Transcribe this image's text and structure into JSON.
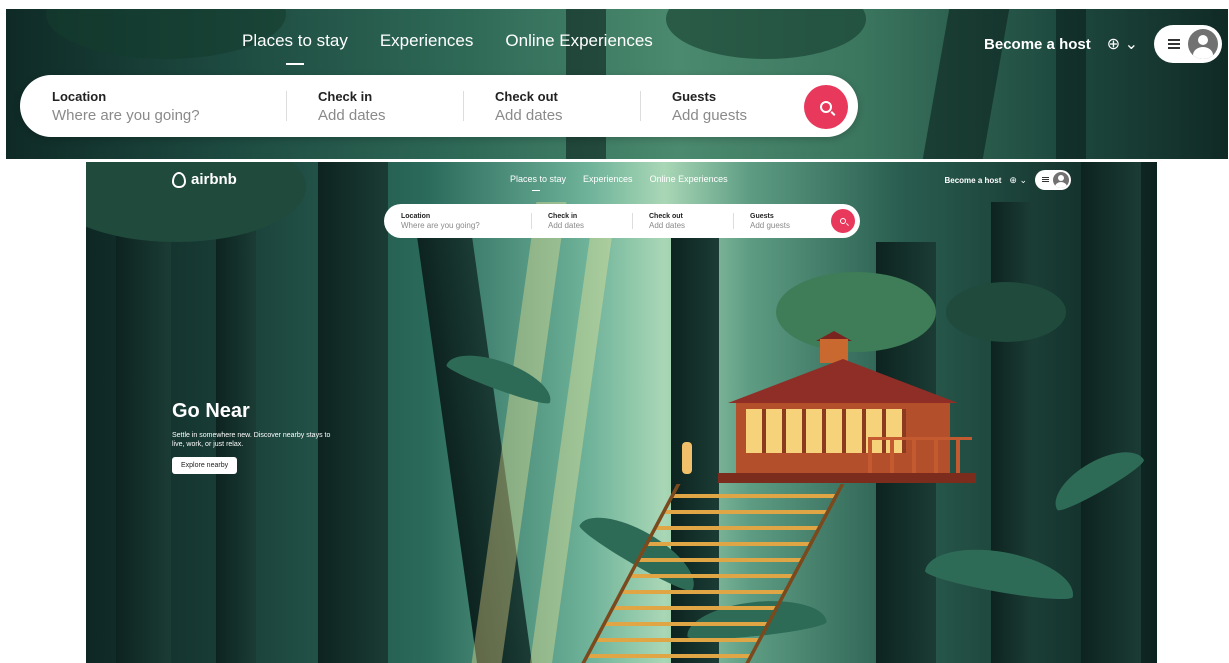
{
  "nav": {
    "items": [
      "Places to stay",
      "Experiences",
      "Online Experiences"
    ],
    "active_index": 0
  },
  "header": {
    "logo_text": "airbnb",
    "become_host": "Become a host",
    "globe_glyph": "⊕",
    "chevron_glyph": "⌄"
  },
  "search": {
    "fields": [
      {
        "label": "Location",
        "value": "Where are you going?"
      },
      {
        "label": "Check in",
        "value": "Add dates"
      },
      {
        "label": "Check out",
        "value": "Add dates"
      },
      {
        "label": "Guests",
        "value": "Add guests"
      }
    ],
    "button_color": "#e8385b"
  },
  "hero": {
    "title": "Go Near",
    "subtitle": "Settle in somewhere new. Discover nearby stays to live, work, or just relax.",
    "button_label": "Explore nearby"
  },
  "icons": {
    "search": "magnifier-icon",
    "menu": "hamburger-menu-icon",
    "user": "user-avatar-icon",
    "globe": "globe-icon"
  }
}
